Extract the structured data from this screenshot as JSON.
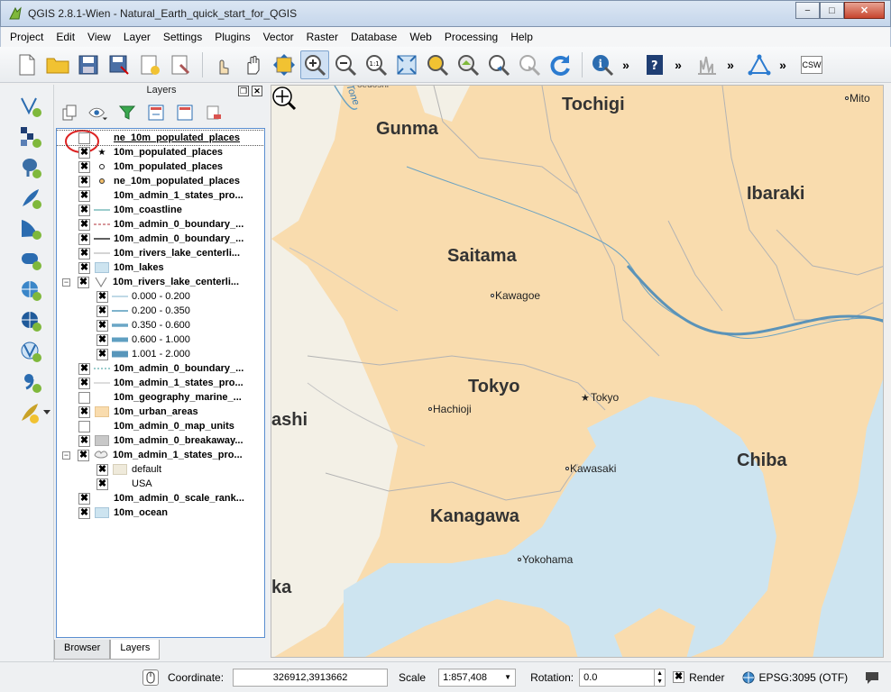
{
  "window": {
    "title": "QGIS 2.8.1-Wien - Natural_Earth_quick_start_for_QGIS",
    "minimize": "−",
    "maximize": "□",
    "close": "✕"
  },
  "menu": [
    "Project",
    "Edit",
    "View",
    "Layer",
    "Settings",
    "Plugins",
    "Vector",
    "Raster",
    "Database",
    "Web",
    "Processing",
    "Help"
  ],
  "toolbar": {
    "more": "»",
    "csw_label": "CSW"
  },
  "layers_panel": {
    "title": "Layers",
    "float_btn": "❐",
    "close_btn": "✕",
    "tabs": [
      "Browser",
      "Layers"
    ],
    "active_tab": "Layers",
    "rows": [
      {
        "name": "ne_10m_populated_places",
        "checked": false,
        "symbol": "none",
        "indent": 0,
        "highlighted": true
      },
      {
        "name": "10m_populated_places",
        "checked": true,
        "symbol": "star",
        "indent": 0
      },
      {
        "name": "10m_populated_places",
        "checked": true,
        "symbol": "dot",
        "indent": 0
      },
      {
        "name": "ne_10m_populated_places",
        "checked": true,
        "symbol": "dot-orange",
        "indent": 0
      },
      {
        "name": "10m_admin_1_states_pro...",
        "checked": true,
        "symbol": "none",
        "indent": 0
      },
      {
        "name": "10m_coastline",
        "checked": true,
        "symbol": "line-teal",
        "indent": 0
      },
      {
        "name": "10m_admin_0_boundary_...",
        "checked": true,
        "symbol": "line-red-dash",
        "indent": 0
      },
      {
        "name": "10m_admin_0_boundary_...",
        "checked": true,
        "symbol": "line-black",
        "indent": 0
      },
      {
        "name": "10m_rivers_lake_centerli...",
        "checked": true,
        "symbol": "line-grey",
        "indent": 0
      },
      {
        "name": "10m_lakes",
        "checked": true,
        "symbol": "fill-lightblue",
        "indent": 0
      },
      {
        "name": "10m_rivers_lake_centerli...",
        "checked": true,
        "symbol": "graduated",
        "indent": 0,
        "expander": "⊟"
      },
      {
        "name": "0.000 - 0.200",
        "checked": true,
        "symbol": "line-blue-1",
        "indent": 1
      },
      {
        "name": "0.200 - 0.350",
        "checked": true,
        "symbol": "line-blue-2",
        "indent": 1
      },
      {
        "name": "0.350 - 0.600",
        "checked": true,
        "symbol": "line-blue-3",
        "indent": 1
      },
      {
        "name": "0.600 - 1.000",
        "checked": true,
        "symbol": "line-blue-4",
        "indent": 1
      },
      {
        "name": "1.001 - 2.000",
        "checked": true,
        "symbol": "line-blue-5",
        "indent": 1
      },
      {
        "name": "10m_admin_0_boundary_...",
        "checked": true,
        "symbol": "line-teal-dash",
        "indent": 0
      },
      {
        "name": "10m_admin_1_states_pro...",
        "checked": true,
        "symbol": "line-lightgrey",
        "indent": 0
      },
      {
        "name": "10m_geography_marine_...",
        "checked": false,
        "symbol": "none",
        "indent": 0
      },
      {
        "name": "10m_urban_areas",
        "checked": true,
        "symbol": "fill-tan",
        "indent": 0
      },
      {
        "name": "10m_admin_0_map_units",
        "checked": false,
        "symbol": "none",
        "indent": 0
      },
      {
        "name": "10m_admin_0_breakaway...",
        "checked": true,
        "symbol": "fill-grey",
        "indent": 0
      },
      {
        "name": "10m_admin_1_states_pro...",
        "checked": true,
        "symbol": "categorized",
        "indent": 0,
        "expander": "⊟"
      },
      {
        "name": "default",
        "checked": true,
        "symbol": "fill-beige",
        "indent": 1,
        "plain": true
      },
      {
        "name": "USA",
        "checked": true,
        "symbol": "none",
        "indent": 1,
        "plain": true
      },
      {
        "name": "10m_admin_0_scale_rank...",
        "checked": true,
        "symbol": "none",
        "indent": 0
      },
      {
        "name": "10m_ocean",
        "checked": true,
        "symbol": "fill-ocean",
        "indent": 0
      }
    ]
  },
  "map": {
    "regions": [
      "Tochigi",
      "Gunma",
      "Ibaraki",
      "Saitama",
      "Tokyo",
      "Chiba",
      "Kanagawa",
      "ashi",
      "ka"
    ],
    "cities": [
      "Mito",
      "Kawagoe",
      "Tokyo",
      "Hachioji",
      "Kawasaki",
      "Yokohama",
      "Tone"
    ],
    "partial_top_label": "oedoshi",
    "colors": {
      "land": "#f9dcae",
      "water": "#cde4f0",
      "outside": "#f3f0e6",
      "river": "#6ba2c2"
    }
  },
  "statusbar": {
    "coordinate_label": "Coordinate:",
    "coordinate_value": "326912,3913662",
    "scale_label": "Scale",
    "scale_value": "1:857,408",
    "rotation_label": "Rotation:",
    "rotation_value": "0.0",
    "render_label": "Render",
    "crs_label": "EPSG:3095 (OTF)"
  }
}
